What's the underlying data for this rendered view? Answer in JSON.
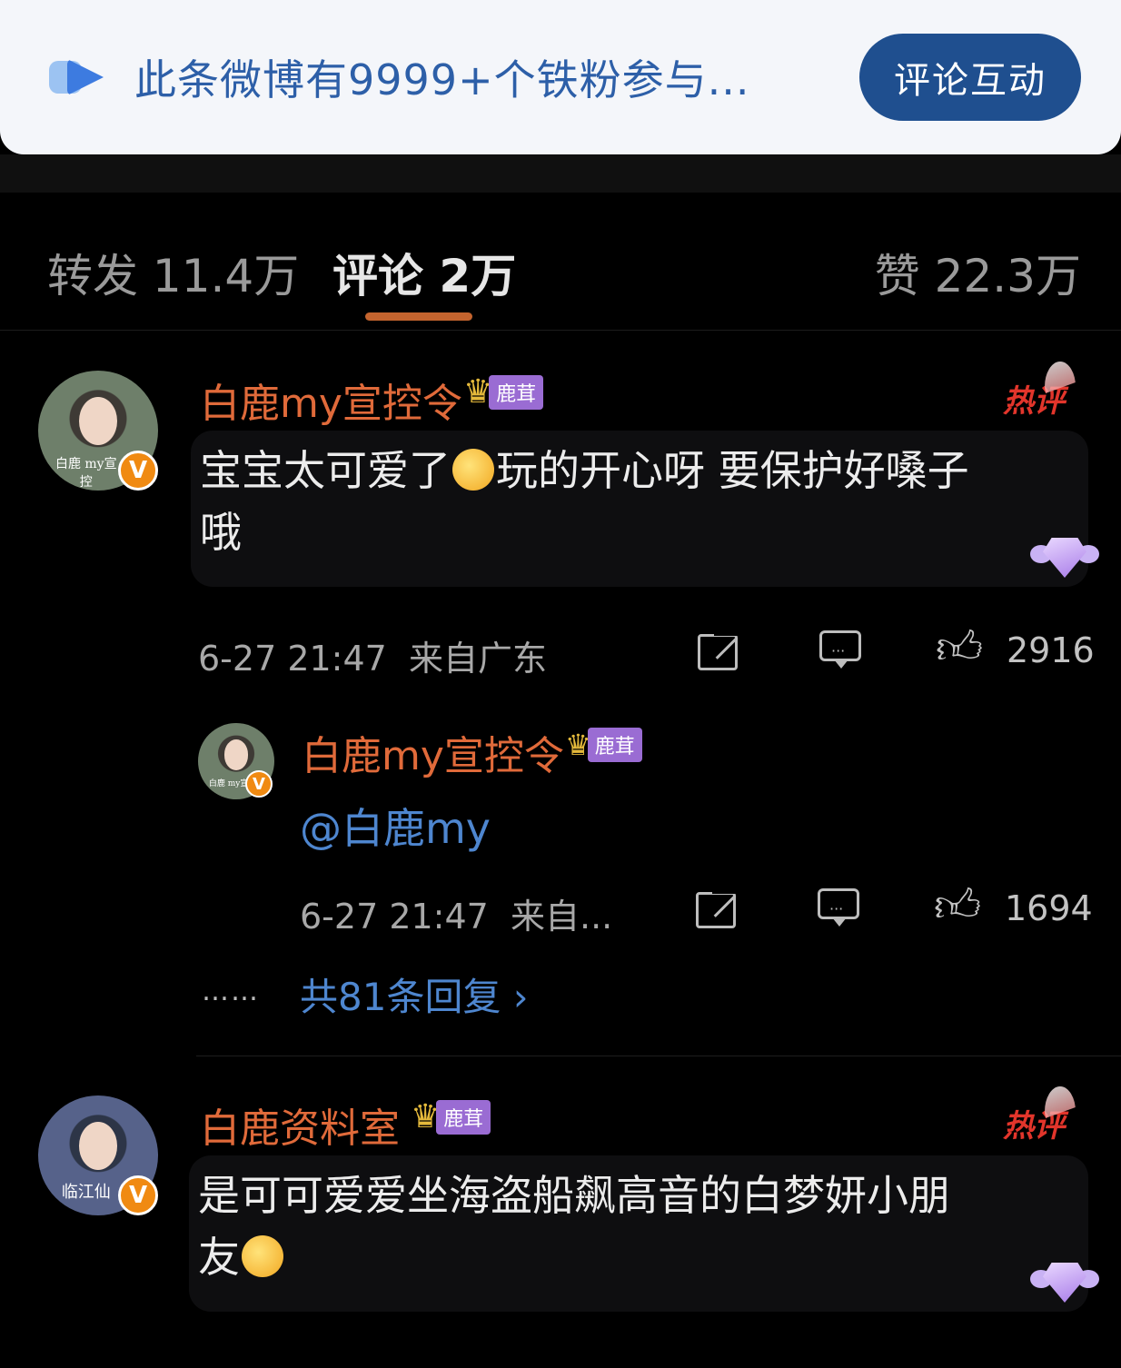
{
  "banner": {
    "text": "此条微博有9999+个铁粉参与...",
    "button": "评论互动",
    "icon": "play-toggle-icon"
  },
  "tabs": {
    "repost": "转发 11.4万",
    "comments": "评论 2万",
    "likes": "赞 22.3万",
    "active": "comments"
  },
  "comments": [
    {
      "username": "白鹿my宣控令",
      "badge_tag": "鹿茸",
      "hot_label": "热评",
      "avatar_caption": "白鹿 my宣控",
      "text_part1": "宝宝太可爱了",
      "text_part2": "玩的开心呀 要保护好嗓子",
      "text_line2": "哦",
      "time": "6-27 21:47",
      "location": "来自广东",
      "likes": "2916",
      "reply": {
        "username": "白鹿my宣控令",
        "badge_tag": "鹿茸",
        "avatar_caption": "白鹿 my宣",
        "text": "@白鹿my",
        "time": "6-27 21:47",
        "location": "来自...",
        "likes": "1694"
      },
      "dots": "……",
      "reply_count": "共81条回复 ›"
    },
    {
      "username": "白鹿资料室",
      "badge_tag": "鹿茸",
      "hot_label": "热评",
      "avatar_caption": "临江仙",
      "text_line1": "是可可爱爱坐海盗船飙高音的白梦妍小朋",
      "text_line2": "友"
    }
  ],
  "colors": {
    "username": "#e06a3a",
    "link": "#4e86cf",
    "tab_underline": "#c4642e",
    "banner_button": "#1f4f8f"
  }
}
